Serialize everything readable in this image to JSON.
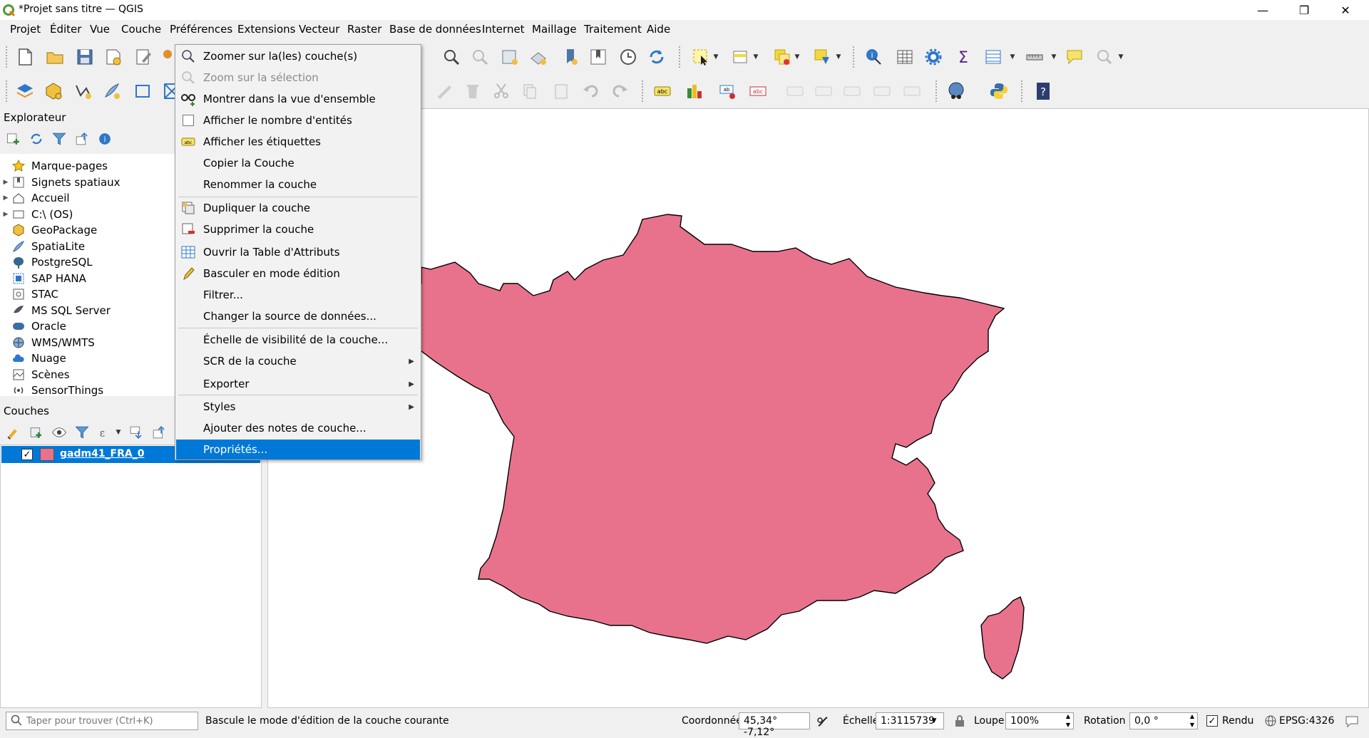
{
  "window": {
    "title": "*Projet sans titre — QGIS",
    "minimize_icon": "minimize-icon",
    "maximize_icon": "restore-icon",
    "close_icon": "close-icon"
  },
  "menubar": [
    "Projet",
    "Éditer",
    "Vue",
    "Couche",
    "Préférences",
    "Extensions",
    "Vecteur",
    "Raster",
    "Base de données",
    "Internet",
    "Maillage",
    "Traitement",
    "Aide"
  ],
  "explorer": {
    "title": "Explorateur",
    "items": [
      {
        "label": "Marque-pages",
        "icon": "star-icon",
        "expandable": false
      },
      {
        "label": "Signets spatiaux",
        "icon": "spatial-bookmarks-icon",
        "expandable": true
      },
      {
        "label": "Accueil",
        "icon": "home-icon",
        "expandable": true
      },
      {
        "label": "C:\\ (OS)",
        "icon": "drive-icon",
        "expandable": true
      },
      {
        "label": "GeoPackage",
        "icon": "geopackage-icon",
        "expandable": false
      },
      {
        "label": "SpatiaLite",
        "icon": "spatialite-icon",
        "expandable": false
      },
      {
        "label": "PostgreSQL",
        "icon": "postgresql-icon",
        "expandable": false
      },
      {
        "label": "SAP HANA",
        "icon": "sap-hana-icon",
        "expandable": false
      },
      {
        "label": "STAC",
        "icon": "stac-icon",
        "expandable": false
      },
      {
        "label": "MS SQL Server",
        "icon": "mssql-icon",
        "expandable": false
      },
      {
        "label": "Oracle",
        "icon": "oracle-icon",
        "expandable": false
      },
      {
        "label": "WMS/WMTS",
        "icon": "wms-icon",
        "expandable": false
      },
      {
        "label": "Nuage",
        "icon": "cloud-icon",
        "expandable": false
      },
      {
        "label": "Scènes",
        "icon": "scenes-icon",
        "expandable": false
      },
      {
        "label": "SensorThings",
        "icon": "sensorthings-icon",
        "expandable": false
      }
    ]
  },
  "layers": {
    "title": "Couches",
    "items": [
      {
        "label": "gadm41_FRA_0",
        "checked": true,
        "color": "#e8728c"
      }
    ]
  },
  "context_menu": {
    "items": [
      {
        "label": "Zoomer sur la(les) couche(s)",
        "icon": "zoom-layer-icon",
        "state": "normal"
      },
      {
        "label": "Zoom sur la sélection",
        "icon": "zoom-selection-icon",
        "state": "disabled"
      },
      {
        "label": "Montrer dans la vue d'ensemble",
        "icon": "overview-icon",
        "state": "normal"
      },
      {
        "label": "Afficher le nombre d'entités",
        "icon": "checkbox-icon",
        "state": "normal"
      },
      {
        "label": "Afficher les étiquettes",
        "icon": "labels-icon",
        "state": "normal"
      },
      {
        "label": "Copier la Couche",
        "icon": "",
        "state": "normal"
      },
      {
        "label": "Renommer la couche",
        "icon": "",
        "state": "normal"
      },
      {
        "label": "Dupliquer la couche",
        "icon": "duplicate-layer-icon",
        "state": "normal"
      },
      {
        "label": "Supprimer la couche",
        "icon": "remove-layer-icon",
        "state": "normal"
      },
      {
        "label": "Ouvrir la Table d'Attributs",
        "icon": "attribute-table-icon",
        "state": "normal"
      },
      {
        "label": "Basculer en mode édition",
        "icon": "pencil-icon",
        "state": "normal"
      },
      {
        "label": "Filtrer...",
        "icon": "",
        "state": "normal"
      },
      {
        "label": "Changer la source de données...",
        "icon": "",
        "state": "normal"
      },
      {
        "label": "Échelle de visibilité de la couche...",
        "icon": "",
        "state": "normal"
      },
      {
        "label": "SCR de la couche",
        "icon": "",
        "state": "submenu"
      },
      {
        "label": "Exporter",
        "icon": "",
        "state": "submenu"
      },
      {
        "label": "Styles",
        "icon": "",
        "state": "submenu"
      },
      {
        "label": "Ajouter des notes de couche...",
        "icon": "",
        "state": "normal"
      },
      {
        "label": "Propriétés...",
        "icon": "",
        "state": "selected"
      }
    ]
  },
  "statusbar": {
    "search_placeholder": "Taper pour trouver (Ctrl+K)",
    "message": "Bascule le mode d'édition de la couche courante",
    "coord_label": "Coordonnée",
    "coord_value": "45,34° -7,12°",
    "scale_label": "Échelle",
    "scale_value": "1:3115739",
    "magnifier_label": "Loupe",
    "magnifier_value": "100%",
    "rotation_label": "Rotation",
    "rotation_value": "0,0 °",
    "render_label": "Rendu",
    "render_checked": true,
    "crs": "EPSG:4326"
  },
  "colors": {
    "layer_fill": "#e8728c",
    "selection": "#0078d7"
  }
}
